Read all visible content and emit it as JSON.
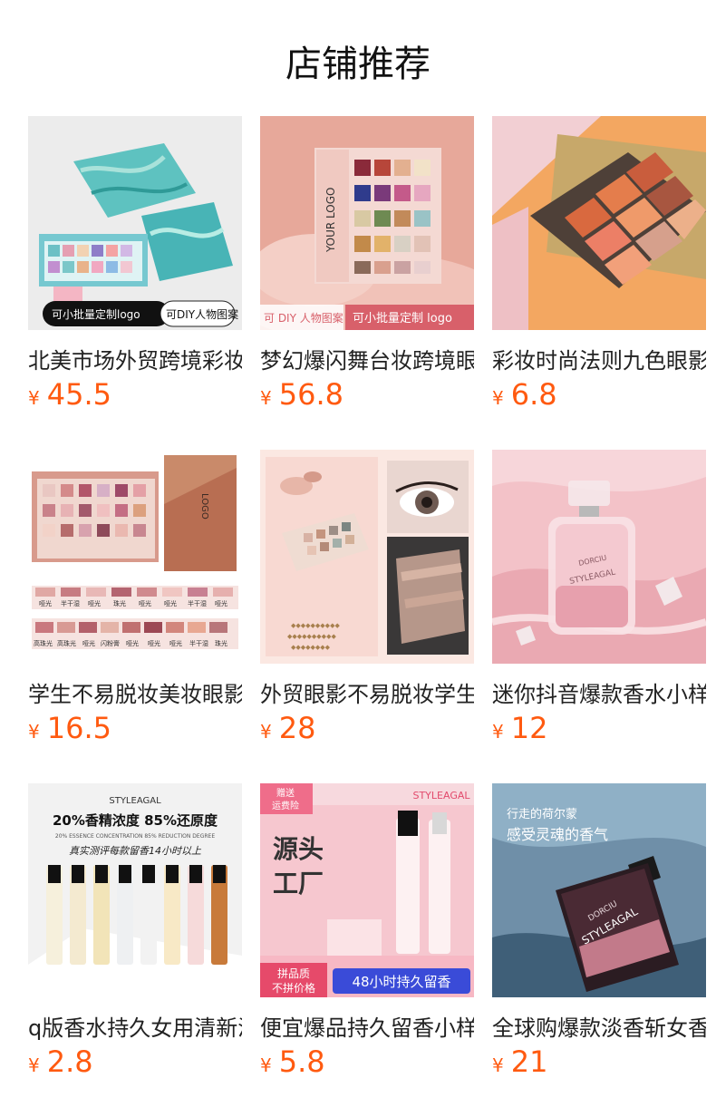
{
  "header": {
    "title": "店铺推荐"
  },
  "currency_symbol": "¥",
  "products": [
    {
      "name": "北美市场外贸跨境彩妆眼影盘",
      "price": "45.5",
      "image": {
        "labels": [
          "可小批量定制logo",
          "可DIY人物图案"
        ]
      }
    },
    {
      "name": "梦幻爆闪舞台妆跨境眼影盘",
      "price": "56.8",
      "image": {
        "labels": [
          "YOUR LOGO",
          "可 DIY 人物图案",
          "可小批量定制 logo"
        ]
      }
    },
    {
      "name": "彩妆时尚法则九色眼影盘",
      "price": "6.8",
      "image": {
        "labels": []
      }
    },
    {
      "name": "学生不易脱妆美妆眼影盘",
      "price": "16.5",
      "image": {
        "labels": [
          "LOGO"
        ],
        "swatch_row1": [
          "哑光",
          "半干湿",
          "哑光",
          "珠光",
          "哑光",
          "哑光",
          "半干湿",
          "哑光"
        ],
        "swatch_row2": [
          "高珠光",
          "高珠光",
          "哑光",
          "闪粉膏",
          "哑光",
          "哑光",
          "哑光",
          "半干湿",
          "珠光"
        ]
      }
    },
    {
      "name": "外贸眼影不易脱妆学生眼影盘",
      "price": "28",
      "image": {
        "labels": []
      }
    },
    {
      "name": "迷你抖音爆款香水小样",
      "price": "12",
      "image": {
        "labels": [
          "DORCIU",
          "STYLEAGAL"
        ]
      }
    },
    {
      "name": "q版香水持久女用清新淡香",
      "price": "2.8",
      "image": {
        "labels": [
          "STYLEAGAL",
          "20%香精浓度  85%还原度",
          "20% ESSENCE CONCENTRATION 85% REDUCTION DEGREE",
          "真实测评每款留香14小时以上"
        ]
      }
    },
    {
      "name": "便宜爆品持久留香小样香水",
      "price": "5.8",
      "image": {
        "labels": [
          "赠送",
          "运费险",
          "STYLEAGAL",
          "源头",
          "工厂",
          "拼品质",
          "不拼价格",
          "48小时持久留香"
        ]
      }
    },
    {
      "name": "全球购爆款淡香斩女香水",
      "price": "21",
      "image": {
        "labels": [
          "行走的荷尔蒙",
          "感受灵魂的香气",
          "DORCIU",
          "STYLEAGAL"
        ]
      }
    }
  ],
  "colors": {
    "price": "#ff5a10",
    "title": "#111111",
    "name": "#222222"
  }
}
